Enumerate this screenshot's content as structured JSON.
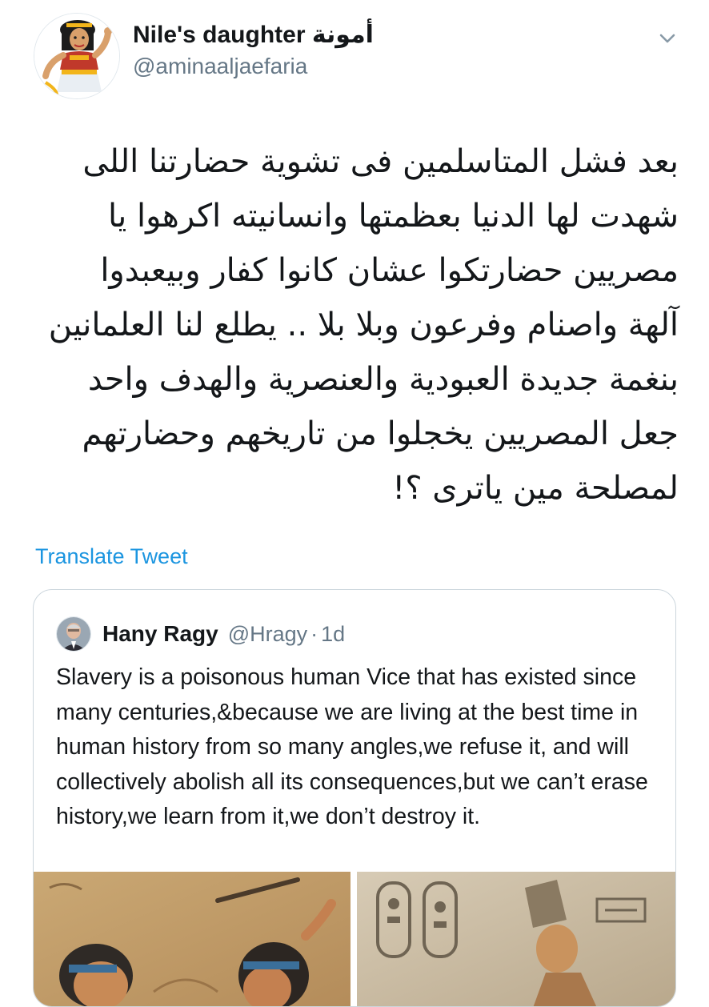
{
  "tweet": {
    "author": {
      "display_name": "Nile's daughter أمونة",
      "handle": "@aminaaljaefaria",
      "avatar_icon": "cartoon-pharaonic-woman-avatar"
    },
    "text_lines": [
      "بعد فشل المتاسلمين فى تشوية حضارتنا اللى",
      "شهدت لها الدنيا بعظمتها وانسانيته اكرهوا يا",
      "مصريين حضارتكوا عشان كانوا كفار وبيعبدوا",
      "آلهة واصنام وفرعون وبلا بلا .. يطلع لنا العلمانين",
      "بنغمة جديدة العبودية والعنصرية والهدف واحد",
      "جعل المصريين يخجلوا من تاريخهم وحضارتهم",
      "لمصلحة مين ياترى ؟!"
    ],
    "translate_label": "Translate Tweet",
    "menu_icon": "chevron-down-icon"
  },
  "quoted_tweet": {
    "display_name": "Hany Ragy",
    "handle": "@Hragy",
    "separator": "·",
    "time": "1d",
    "text": "Slavery is a poisonous human Vice that has existed since many centuries,&because we are living at the best time in human history from so many angles,we refuse it, and will collectively abolish all its consequences,but we can’t erase history,we learn from it,we don’t destroy it.",
    "media": [
      {
        "icon": "ancient-egyptian-relief-image"
      },
      {
        "icon": "pharaoh-relief-image"
      }
    ]
  },
  "colors": {
    "text": "#14171a",
    "secondary": "#657786",
    "link": "#1b95e0",
    "border": "#ccd6dd"
  }
}
